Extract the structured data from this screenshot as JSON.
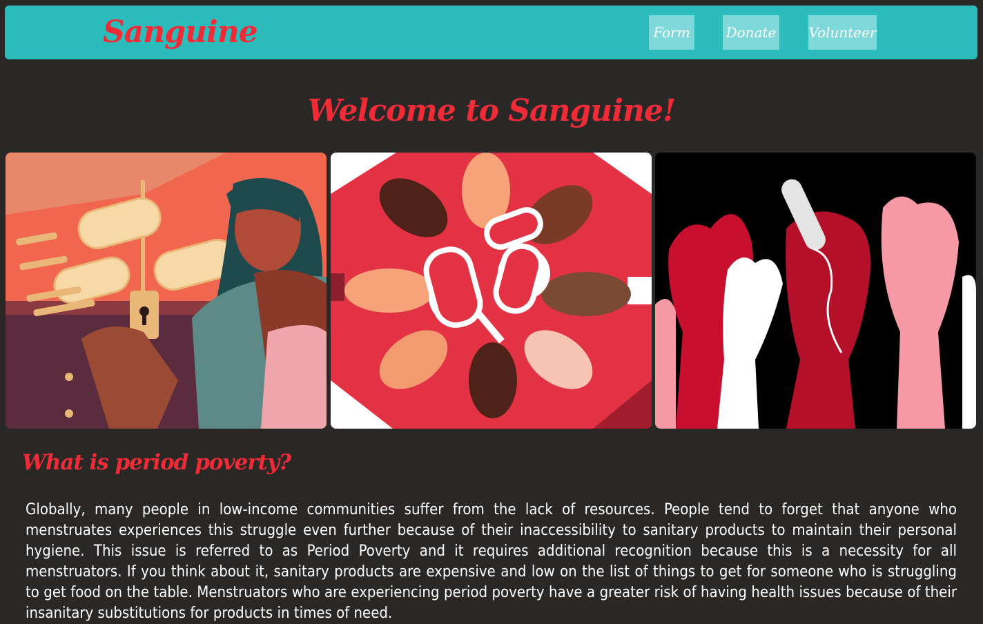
{
  "header": {
    "brand": "Sanguine",
    "nav": [
      {
        "label": "Form"
      },
      {
        "label": "Donate"
      },
      {
        "label": "Volunteer"
      }
    ]
  },
  "welcome": "Welcome to Sanguine!",
  "gallery": [
    {
      "icon": "woman-at-locked-product-case-illustration"
    },
    {
      "icon": "hands-reaching-for-pads-illustration"
    },
    {
      "icon": "raised-hands-holding-tampon-illustration"
    }
  ],
  "section": {
    "title": "What is period poverty?",
    "body": "Globally, many people in low-income communities suffer from the lack of resources. People tend to forget that anyone who menstruates experiences this struggle even further because of their inaccessibility to sanitary products to maintain their personal hygiene. This issue is referred to as Period Poverty and it requires additional recognition because this is a necessity for all menstruators. If you think about it, sanitary products are expensive and low on the list of things to get for someone who is struggling to get food on the table. Menstruators who are experiencing period poverty have a greater risk of having health issues because of their insanitary substitutions for products in times of need."
  },
  "colors": {
    "background": "#2a2827",
    "navbar": "#2bbcbb",
    "nav_button": "#7fd8d9",
    "accent": "#ee2b37"
  }
}
